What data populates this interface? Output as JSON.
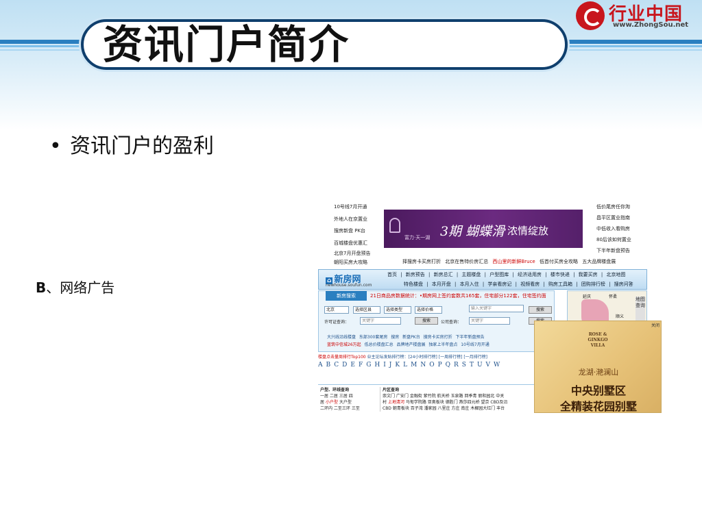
{
  "header": {
    "title": "资讯门户简介",
    "logo_cn": "行业中国",
    "logo_url": "www.ZhongSou.net"
  },
  "bullet": {
    "marker": "•",
    "text": "资讯门户的盈利"
  },
  "subheading": {
    "letter": "B",
    "text": "、网络广告"
  },
  "screenshot": {
    "left_links": [
      "10号线7月开通",
      "外地人在京置业",
      "搜房新盘 PK台",
      "百城楼盘优惠汇",
      "北京7月开盘预告",
      "朝阳买房大攻略"
    ],
    "right_links": [
      "低价尾房任你淘",
      "昌平区置业指南",
      "中低收入看购房",
      "80后该如何置业",
      "下半年新盘预告"
    ],
    "banner": {
      "tag": "富力·天一湖",
      "main": "3期 蝴蝶滑",
      "sub": "浓情绽放"
    },
    "link_row": [
      {
        "text": "择搜房卡买房打折",
        "hot": false
      },
      {
        "text": "北京在售特价房汇总",
        "hot": false
      },
      {
        "text": "西山里的新鲜Bruce",
        "hot": true
      },
      {
        "text": "低首付买房全攻略",
        "hot": false
      },
      {
        "text": "五大品牌楼盘展",
        "hot": false
      }
    ],
    "nav": {
      "site_name": "新房网",
      "site_url": "newhouse.soufun.com",
      "row1": "首页 | 新房预告 | 新房总汇 | 主题楼盘 | 户型图库 | 经济适用房 | 楼市快递 | 我要买房 | 北京地图",
      "row2": "特色楼盘 | 本月开盘 | 本月入住 | 学亲看房记 | 视频看房 | 购房工具箱 | 团购排行榜 | 搜房问答"
    },
    "search": {
      "tab": "新房搜索",
      "stat": "21日商品房数据统计：•期房网上签约套数共165套，住宅部分122套，住宅签约面",
      "city": "北京",
      "district": "选择区县",
      "type": "选择类型",
      "price": "选择价格",
      "keyword_placeholder": "输入关键字",
      "search_btn": "搜索",
      "license_label": "许可证查询：",
      "license_placeholder": "关键字",
      "company_label": "公司查询：",
      "company_placeholder": "关键字",
      "links1": "大兴线沿线楼盘  东部300套尾房  搜房 新盘PK台  搜房卡买房打折  下半年新盘预告",
      "links2_hot": "蓝筑中信城26万起",
      "links2_rest": "低总价楼盘汇总  品牌地产楼盘展  独家上半年盘点  10号线7月开通"
    },
    "map_labels": {
      "a": "延庆",
      "b": "怀柔",
      "c": "顺义",
      "btn": "地图查询"
    },
    "rank_line": {
      "hot": "楼盘点击量周排行Top100",
      "rest": "业主论坛发贴排行榜：[24小时排行榜] [一周排行榜] [一月排行榜]"
    },
    "alphabet": "ABCDEFGHIJKLMNOPQRSTUVW",
    "bottom": {
      "col1_title": "户型、环线查询",
      "col1_r1": "一居 二居 三居 四",
      "col1_r2_pre": "居",
      "col1_r2_hot": "小户型",
      "col1_r2_post": "大户型",
      "col1_r3": "二环内 二至三环 三至",
      "col2_title": "片区查询",
      "col2_r1": "崇文门 广安门 金融街 紫竹院 航天桥 玉泉路 回季青 丽和园北 中关",
      "col2_r2_pre": "村",
      "col2_r2_hot": "上地清河",
      "col2_r2_post": "马甸学院路 亚奥板块 德胜门 燕莎四元桥 望京 CBD及沿",
      "col2_r3": "CBD 朝青板块 百子湾 潘家园 八里庄 方庄 南庄 木樨园大红门 丰台"
    },
    "ad": {
      "close": "关闭",
      "brand": "ROSE & GINKGO VILLA",
      "line1": "龙湖·滟澜山",
      "line2": "中央别墅区",
      "line3": "全精装花园别墅"
    }
  }
}
